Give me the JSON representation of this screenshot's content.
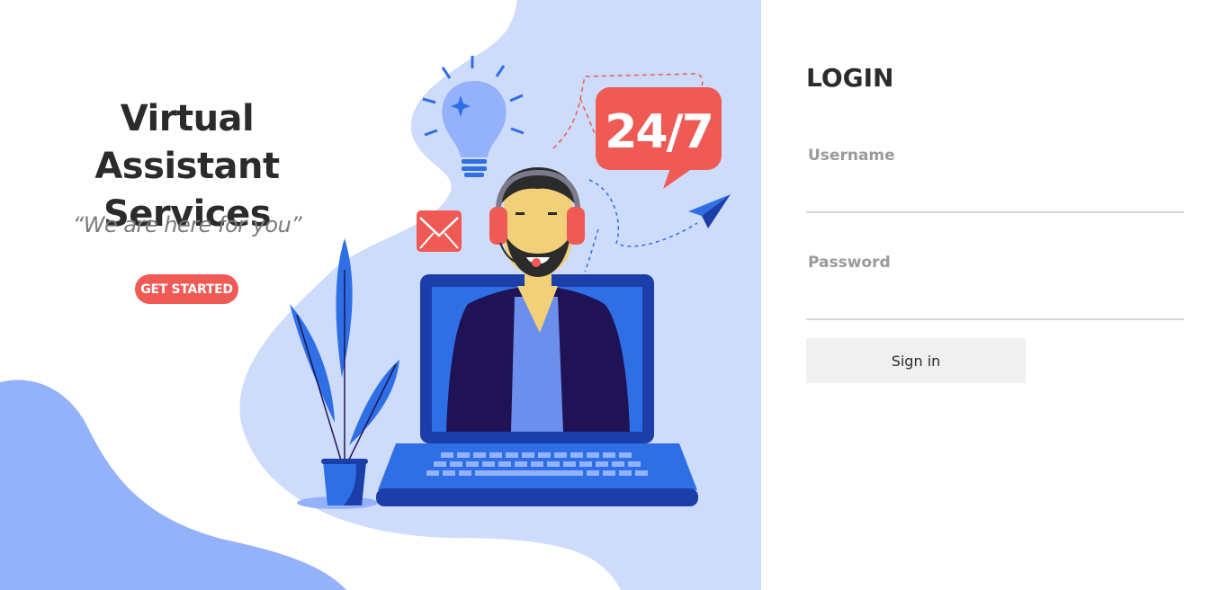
{
  "hero": {
    "title_line1": "Virtual Assistant",
    "title_line2": "Services",
    "tagline": "“We are here for you”",
    "cta_label": "GET STARTED",
    "badge_text": "24/7"
  },
  "login": {
    "title": "LOGIN",
    "username_label": "Username",
    "username_value": "",
    "password_label": "Password",
    "password_value": "",
    "signin_label": "Sign in"
  },
  "colors": {
    "accent_red": "#ef5a55",
    "light_blue_bg": "#cedcfb",
    "medium_blue": "#94b1fb",
    "navy": "#1f1356",
    "royal_blue": "#1c3ea8"
  }
}
